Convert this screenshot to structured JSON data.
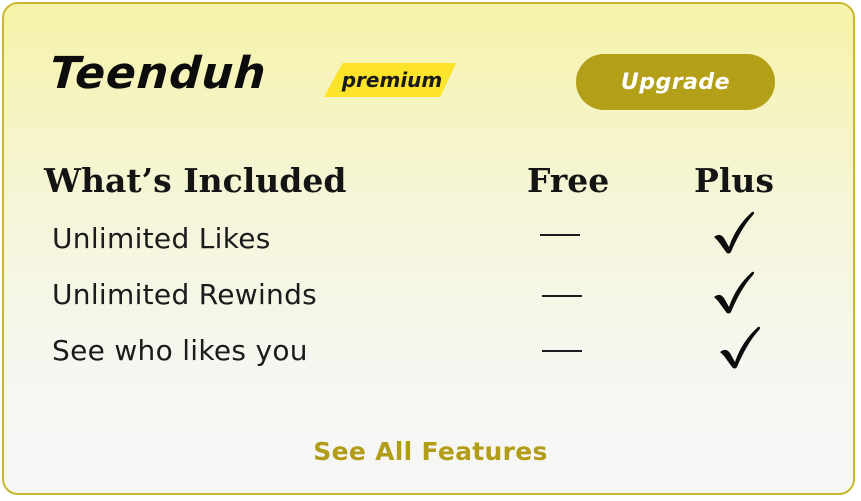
{
  "header": {
    "brand": "Teenduh",
    "badge": "premium",
    "upgrade_label": "Upgrade"
  },
  "table": {
    "columns": [
      "What’s Included",
      "Free",
      "Plus"
    ],
    "rows": [
      {
        "feature": "Unlimited Likes",
        "free": "—",
        "plus": "check"
      },
      {
        "feature": "Unlimited Rewinds",
        "free": "—",
        "plus": "check"
      },
      {
        "feature": "See who likes you",
        "free": "—",
        "plus": "check"
      }
    ]
  },
  "footer": {
    "link_label": "See All Features"
  },
  "icons": {
    "plus_included": "check-icon"
  },
  "colors": {
    "accent": "#b39f18",
    "badge": "#fde42a",
    "border": "#c9b82e"
  }
}
